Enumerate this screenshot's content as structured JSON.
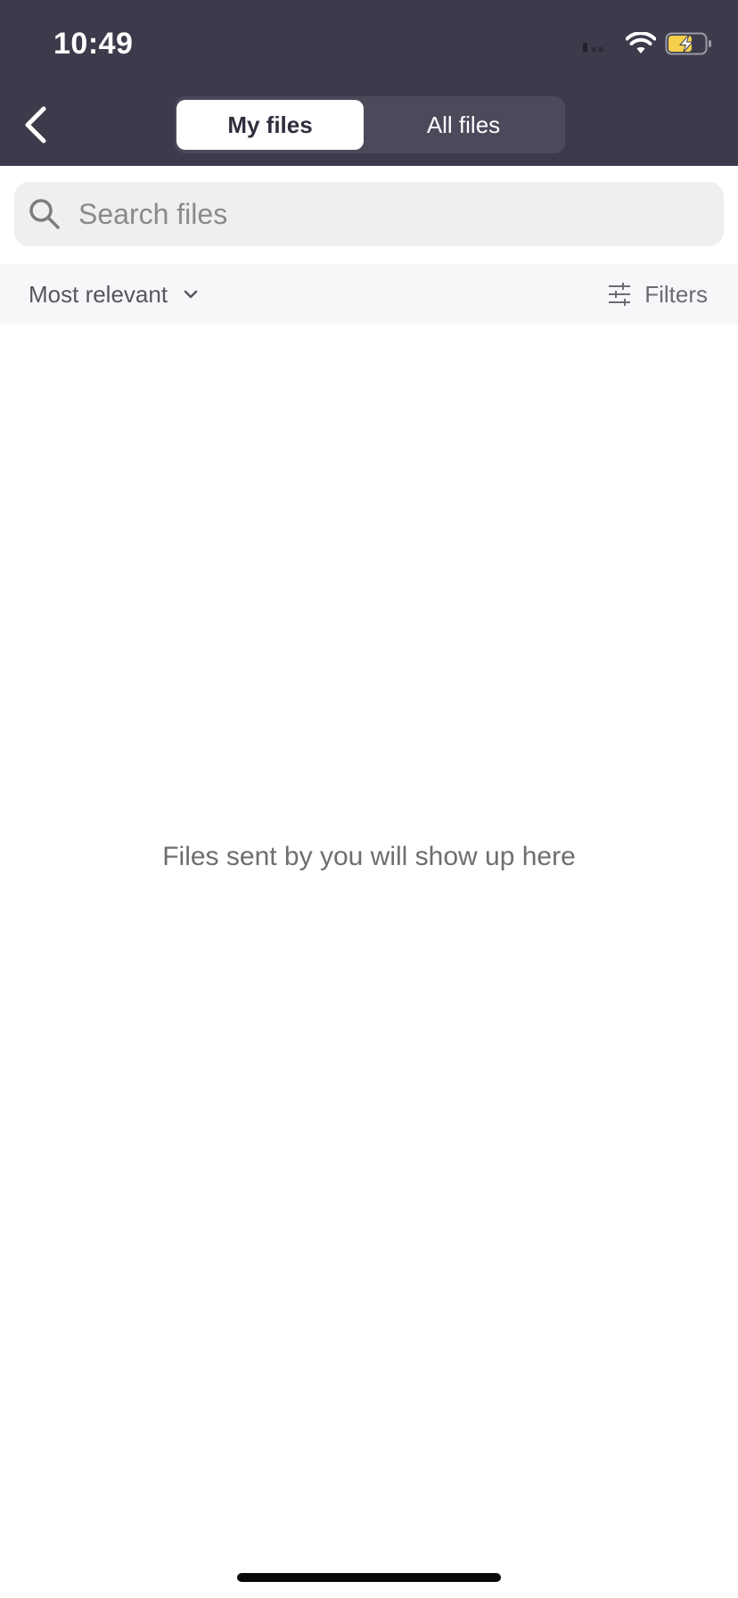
{
  "status_bar": {
    "time": "10:49",
    "icons": [
      "signal-icon",
      "wifi-icon",
      "battery-charging-icon"
    ],
    "battery_color": "#f6d04d"
  },
  "header": {
    "background": "#3c3b4b",
    "back_icon": "chevron-left-icon",
    "tabs": [
      {
        "label": "My files",
        "active": true
      },
      {
        "label": "All files",
        "active": false
      }
    ]
  },
  "search": {
    "placeholder": "Search files",
    "value": ""
  },
  "sort_bar": {
    "sort_label": "Most relevant",
    "filters_label": "Filters"
  },
  "empty_state": {
    "message": "Files sent by you will show up here"
  }
}
